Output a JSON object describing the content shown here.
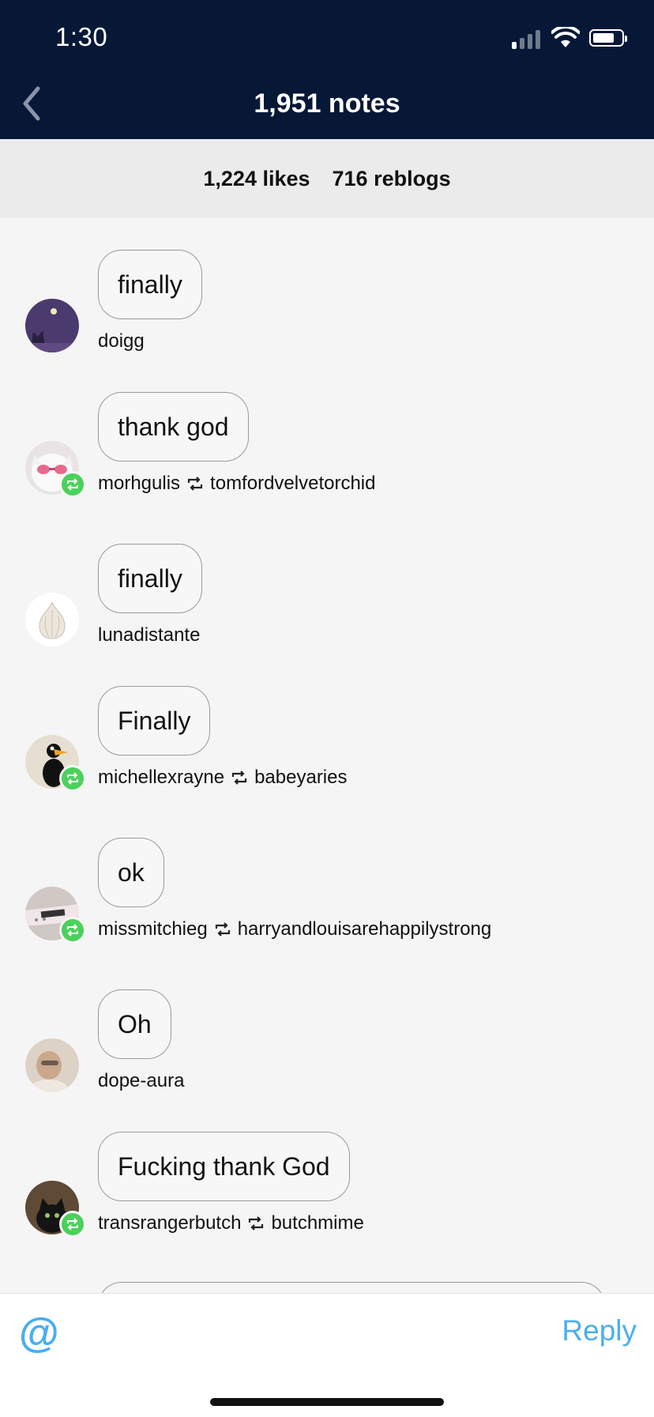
{
  "status_bar": {
    "time": "1:30",
    "battery_level": 0.75
  },
  "header": {
    "title": "1,951 notes"
  },
  "tabs": [
    {
      "label": "1,224 likes"
    },
    {
      "label": "716 reblogs"
    }
  ],
  "notes": [
    {
      "text": "finally",
      "user": "doigg",
      "reblogged_from": "",
      "is_reblog": false,
      "avatar_icon": "moon-cat-avatar"
    },
    {
      "text": "thank god",
      "user": "morhgulis",
      "reblogged_from": "tomfordvelvetorchid",
      "is_reblog": true,
      "avatar_icon": "cat-sunglasses-avatar"
    },
    {
      "text": "finally",
      "user": "lunadistante",
      "reblogged_from": "",
      "is_reblog": false,
      "avatar_icon": "garlic-avatar"
    },
    {
      "text": "Finally",
      "user": "michellexrayne",
      "reblogged_from": "babeyaries",
      "is_reblog": true,
      "avatar_icon": "daffy-duck-avatar"
    },
    {
      "text": "ok",
      "user": "missmitchieg",
      "reblogged_from": "harryandlouisarehappilystrong",
      "is_reblog": true,
      "avatar_icon": "guitar-avatar"
    },
    {
      "text": "Oh",
      "user": "dope-aura",
      "reblogged_from": "",
      "is_reblog": false,
      "avatar_icon": "person-avatar"
    },
    {
      "text": "Fucking thank God",
      "user": "transrangerbutch",
      "reblogged_from": "butchmime",
      "is_reblog": true,
      "avatar_icon": "black-cat-avatar"
    }
  ],
  "footer": {
    "mention_label": "@",
    "reply_label": "Reply"
  },
  "colors": {
    "header_bg": "#071837",
    "accent_blue": "#4aaef1",
    "reblog_green": "#4bd15b"
  }
}
